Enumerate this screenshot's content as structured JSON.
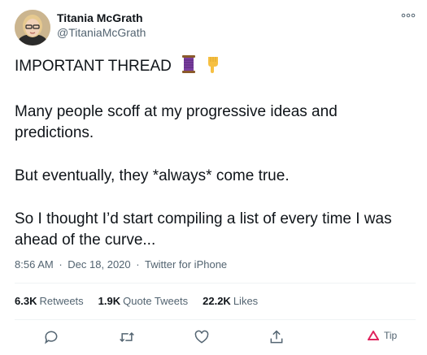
{
  "tweet": {
    "author_name": "Titania McGrath",
    "author_handle": "@TitaniaMcGrath",
    "lines": {
      "title": "IMPORTANT THREAD",
      "p1a": "Many people scoff at my progressive ideas and",
      "p1b": "predictions.",
      "p2": "But eventually, they *always* come true.",
      "p3a": "So I thought I’d start compiling a list of every time I was",
      "p3b": "ahead of the curve..."
    },
    "time": "8:56 AM",
    "date": "Dec 18, 2020",
    "source": "Twitter for iPhone",
    "separator": "·"
  },
  "stats": {
    "retweets_count": "6.3K",
    "retweets_label": "Retweets",
    "quotes_count": "1.9K",
    "quotes_label": "Quote Tweets",
    "likes_count": "22.2K",
    "likes_label": "Likes"
  },
  "actions": {
    "tip_label": "Tip"
  },
  "icons": [
    "more-icon",
    "spool-emoji",
    "pointing-down-emoji",
    "reply-icon",
    "retweet-icon",
    "like-icon",
    "share-icon",
    "tip-icon"
  ],
  "colors": {
    "text": "#0f1419",
    "secondary": "#536471",
    "tip_red": "#e0245e"
  }
}
